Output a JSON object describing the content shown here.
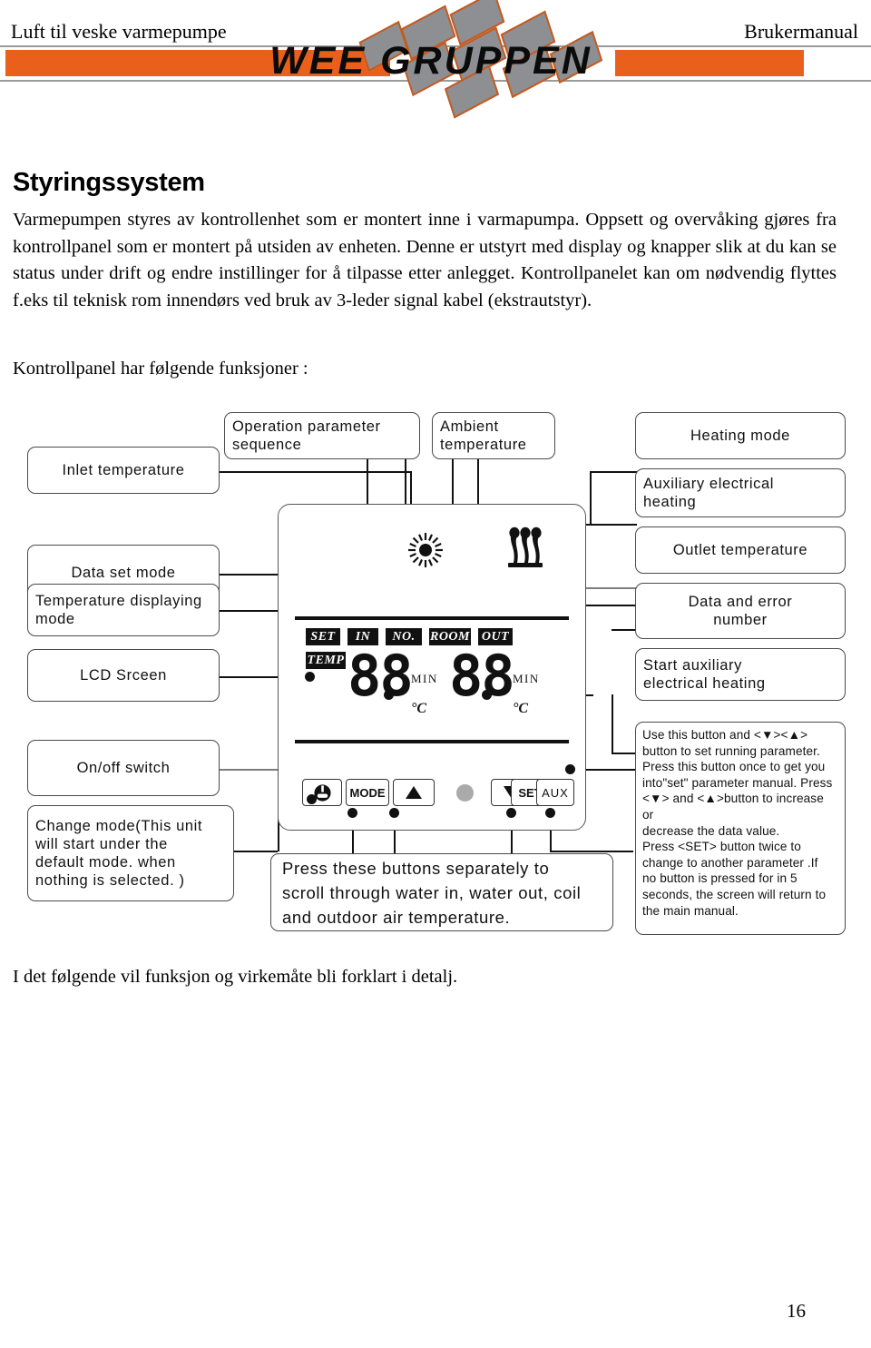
{
  "header": {
    "left_title": "Luft til veske varmepumpe",
    "right_title": "Brukermanual",
    "logo_text": "WEE GRUPPEN",
    "bar_color": "#e8601c",
    "rule_color": "#9a9a9a"
  },
  "content": {
    "heading": "Styringssystem",
    "intro_paragraph": "Varmepumpen styres av kontrollenhet som er montert inne i varmapumpa. Oppsett og overvåking gjøres fra kontrollpanel som er montert på utsiden av enheten. Denne er utstyrt med display og knapper slik at du kan se status under drift og endre instillinger for å tilpasse etter anlegget. Kontrollpanelet kan om nødvendig flyttes f.eks til teknisk rom innendørs ved bruk av 3-leder signal kabel (ekstrautstyr).",
    "functions_line": "Kontrollpanel har følgende funksjoner :",
    "closing_line": "I det følgende vil funksjon og virkemåte bli forklart i detalj.",
    "page_number": "16"
  },
  "diagram": {
    "callouts_left": [
      {
        "id": "inlet-temperature",
        "label": "Inlet temperature"
      },
      {
        "id": "data-set-mode",
        "label": "Data set mode"
      },
      {
        "id": "temperature-display-mode",
        "line1": "Temperature displaying",
        "line2": "mode"
      },
      {
        "id": "lcd-screen",
        "label": "LCD Srceen"
      },
      {
        "id": "on-off-switch",
        "label": "On/off switch"
      }
    ],
    "callouts_top": [
      {
        "id": "operation-parameter-sequence",
        "line1": "Operation parameter",
        "line2": "sequence"
      },
      {
        "id": "ambient-temperature",
        "line1": "Ambient",
        "line2": "temperature"
      }
    ],
    "callouts_right": [
      {
        "id": "heating-mode",
        "label": "Heating mode"
      },
      {
        "id": "auxiliary-electrical-heating",
        "line1": "Auxiliary electrical",
        "line2": "heating"
      },
      {
        "id": "outlet-temperature",
        "label": "Outlet temperature"
      },
      {
        "id": "data-and-error-number",
        "line1": "Data and error",
        "line2": "number"
      },
      {
        "id": "start-auxiliary-heating",
        "line1": "Start auxiliary",
        "line2": "electrical heating"
      }
    ],
    "change_mode_note": {
      "id": "change-mode-note",
      "lines": [
        "Change mode(This unit",
        "will start under the",
        "default mode. when",
        "nothing is selected. )"
      ]
    },
    "scroll_note": {
      "id": "scroll-buttons-note",
      "lines": [
        "Press these buttons separately to",
        "scroll through water in, water out, coil",
        "and outdoor air temperature."
      ]
    },
    "set_button_note": {
      "id": "set-button-note",
      "lines": [
        "Use this button and <▼><▲>",
        "button to set running parameter.",
        "Press this button once to get you",
        "into\"set\" parameter manual. Press",
        "<▼> and <▲>button to increase or",
        "decrease the data value.",
        "Press <SET> button twice to",
        "change to another parameter .If",
        "no button is pressed   for in 5",
        "seconds, the screen will return to",
        "the main manual."
      ]
    }
  },
  "control_panel": {
    "lcd_tags": [
      {
        "id": "tag-set",
        "text": "SET"
      },
      {
        "id": "tag-in",
        "text": "IN"
      },
      {
        "id": "tag-no",
        "text": "NO."
      },
      {
        "id": "tag-room",
        "text": "ROOM"
      },
      {
        "id": "tag-out",
        "text": "OUT"
      },
      {
        "id": "tag-temp",
        "text": "TEMP"
      }
    ],
    "readout_left": {
      "digits": "88",
      "unit_min": "MIN",
      "unit_temp": "°C"
    },
    "readout_right": {
      "digits": "88",
      "unit_min": "MIN",
      "unit_temp": "°C"
    },
    "status_icons": [
      {
        "id": "heating-mode-sun-icon",
        "name": "sun-icon"
      },
      {
        "id": "aux-heat-coil-icon",
        "name": "heating-coil-icon"
      }
    ],
    "buttons": [
      {
        "id": "power-button",
        "label": "⏻"
      },
      {
        "id": "mode-button",
        "label": "MODE"
      },
      {
        "id": "up-button",
        "label": "▲"
      },
      {
        "id": "down-button",
        "label": "▼"
      },
      {
        "id": "set-button",
        "label": "SET"
      },
      {
        "id": "aux-button",
        "label": "AUX"
      }
    ],
    "led_indicator": {
      "id": "status-led",
      "color": "#aaaaaa"
    }
  }
}
